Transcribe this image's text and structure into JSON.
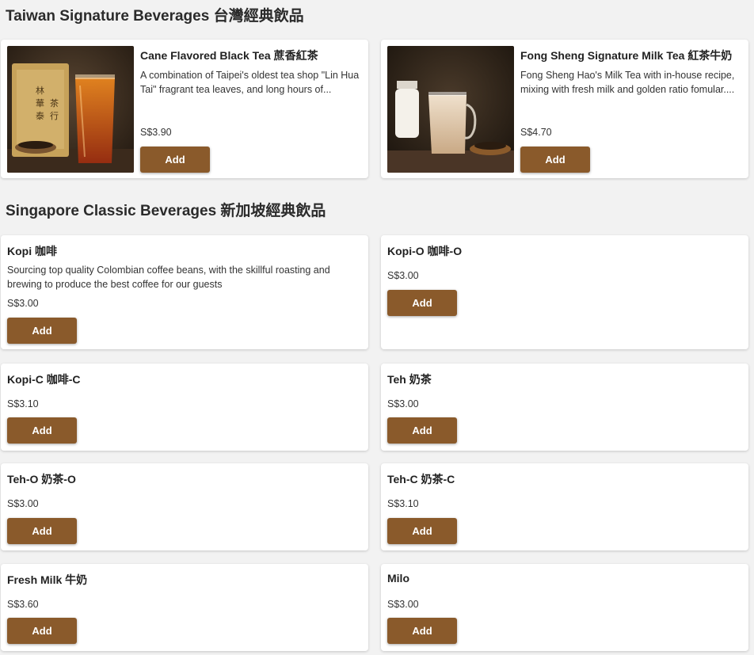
{
  "sections": {
    "taiwan": {
      "title": "Taiwan Signature Beverages 台灣經典飲品"
    },
    "singapore": {
      "title": "Singapore Classic Beverages 新加坡經典飲品"
    }
  },
  "add_label": "Add",
  "taiwan_items": [
    {
      "name": "Cane Flavored Black Tea 蔗香紅茶",
      "description": "A combination of Taipei's oldest tea shop \"Lin Hua Tai\" fragrant tea leaves, and long hours of...",
      "price": "S$3.90",
      "image": "black-tea-photo"
    },
    {
      "name": "Fong Sheng Signature Milk Tea 紅茶牛奶",
      "description": "Fong Sheng Hao's Milk Tea with in-house recipe, mixing with fresh milk and golden ratio fomular....",
      "price": "S$4.70",
      "image": "milk-tea-photo"
    }
  ],
  "singapore_items": [
    {
      "name": "Kopi 咖啡",
      "description": "Sourcing top quality Colombian coffee beans, with the skillful roasting and brewing to produce the best coffee for our guests",
      "price": "S$3.00"
    },
    {
      "name": "Kopi-O 咖啡-O",
      "description": "",
      "price": "S$3.00"
    },
    {
      "name": "Kopi-C 咖啡-C",
      "description": "",
      "price": "S$3.10"
    },
    {
      "name": "Teh 奶茶",
      "description": "",
      "price": "S$3.00"
    },
    {
      "name": "Teh-O 奶茶-O",
      "description": "",
      "price": "S$3.00"
    },
    {
      "name": "Teh-C 奶茶-C",
      "description": "",
      "price": "S$3.10"
    },
    {
      "name": "Fresh Milk 牛奶",
      "description": "",
      "price": "S$3.60"
    },
    {
      "name": "Milo",
      "description": "",
      "price": "S$3.00"
    }
  ],
  "colors": {
    "accent": "#8a5a2b",
    "background": "#f2f2f2",
    "card": "#ffffff"
  }
}
